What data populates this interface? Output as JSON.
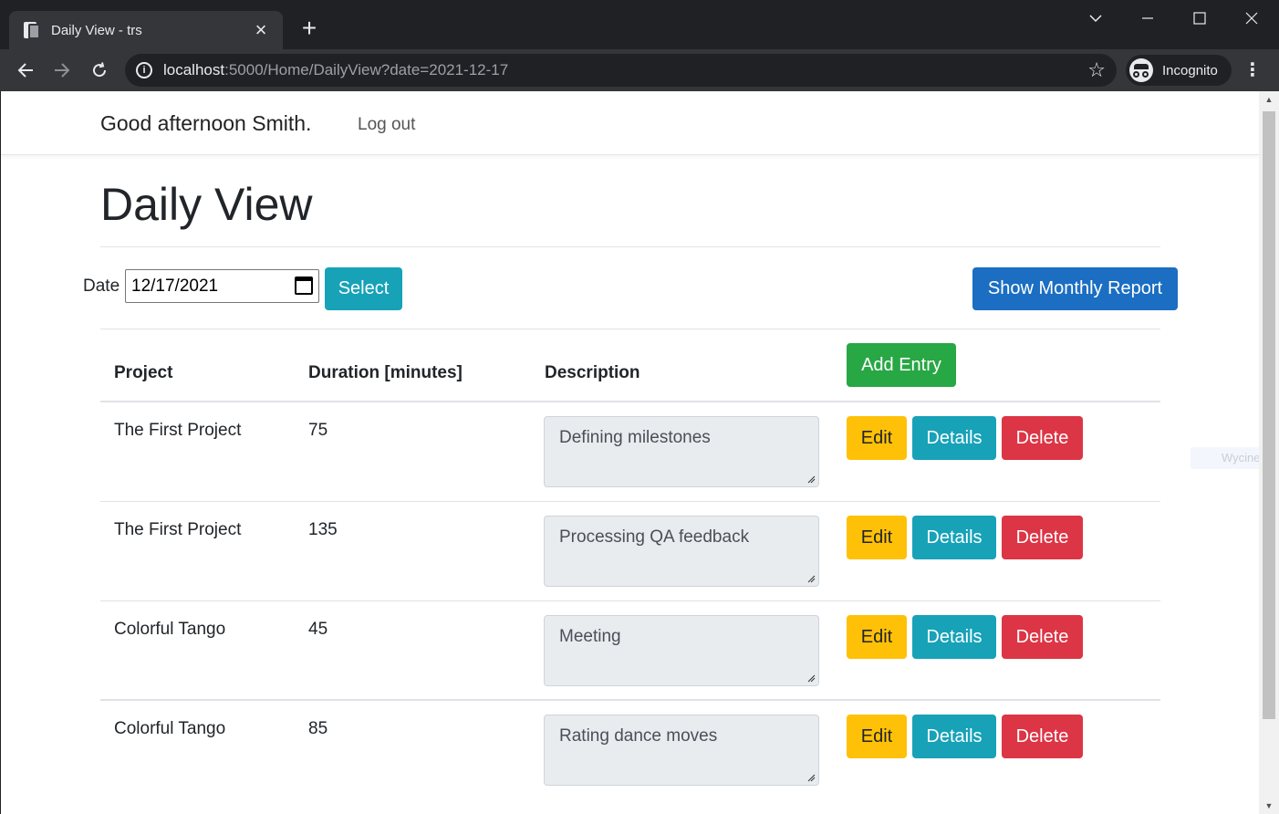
{
  "browser": {
    "tab_title": "Daily View - trs",
    "url_host": "localhost",
    "url_rest": ":5000/Home/DailyView?date=2021-12-17",
    "incognito_label": "Incognito"
  },
  "navbar": {
    "greeting": "Good afternoon Smith.",
    "logout": "Log out"
  },
  "page": {
    "title": "Daily View",
    "date_label": "Date",
    "date_value": "12/17/2021",
    "select_button": "Select",
    "monthly_button": "Show Monthly Report",
    "add_entry_button": "Add Entry"
  },
  "table": {
    "headers": [
      "Project",
      "Duration [minutes]",
      "Description"
    ],
    "rows": [
      {
        "project": "The First Project",
        "duration": "75",
        "description": "Defining milestones"
      },
      {
        "project": "The First Project",
        "duration": "135",
        "description": "Processing QA feedback"
      },
      {
        "project": "Colorful Tango",
        "duration": "45",
        "description": "Meeting"
      },
      {
        "project": "Colorful Tango",
        "duration": "85",
        "description": "Rating dance moves"
      }
    ],
    "actions": {
      "edit": "Edit",
      "details": "Details",
      "delete": "Delete"
    }
  },
  "overlay": {
    "label": "Wycinek"
  },
  "colors": {
    "info": "#17a2b8",
    "primary": "#1b6ec2",
    "success": "#28a745",
    "warning": "#ffc107",
    "danger": "#dc3545"
  }
}
